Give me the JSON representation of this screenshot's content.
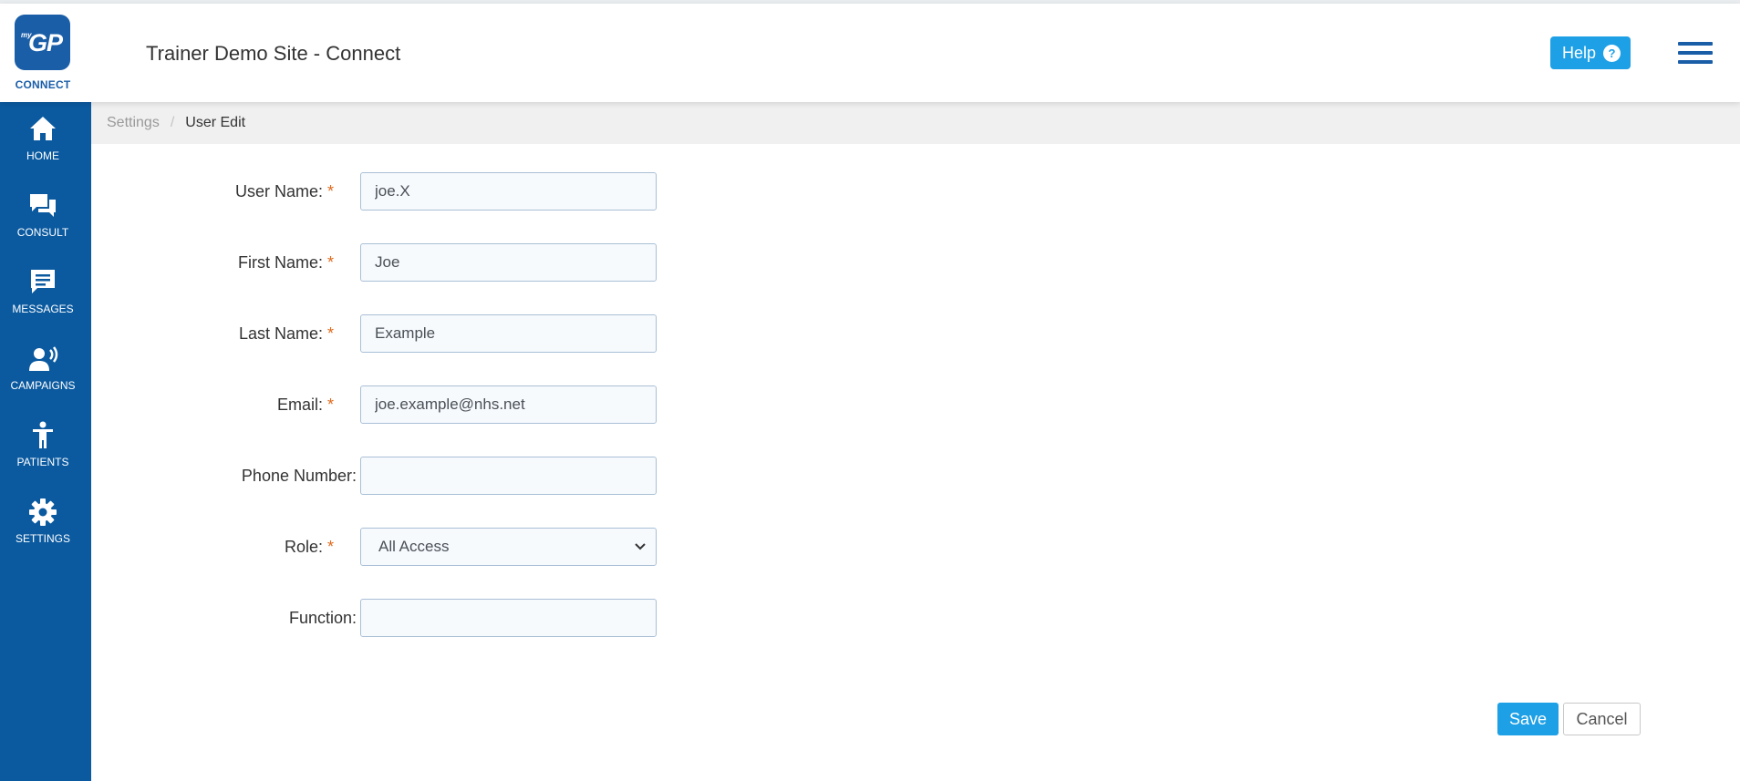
{
  "app": {
    "logo_small": "my",
    "logo_main": "GP",
    "logo_caption": "CONNECT",
    "site_title": "Trainer Demo Site - Connect"
  },
  "header": {
    "help_label": "Help",
    "help_icon": "question-circle-icon",
    "menu_icon": "hamburger-menu-icon"
  },
  "sidebar": {
    "items": [
      {
        "label": "HOME",
        "icon": "home-icon"
      },
      {
        "label": "CONSULT",
        "icon": "chat-bubbles-icon"
      },
      {
        "label": "MESSAGES",
        "icon": "message-icon"
      },
      {
        "label": "CAMPAIGNS",
        "icon": "broadcast-person-icon"
      },
      {
        "label": "PATIENTS",
        "icon": "accessibility-person-icon"
      },
      {
        "label": "SETTINGS",
        "icon": "gear-icon"
      }
    ]
  },
  "breadcrumb": {
    "parent": "Settings",
    "separator": "/",
    "current": "User Edit"
  },
  "form": {
    "required_marker": "*",
    "user_name": {
      "label": "User Name:",
      "value": "joe.X"
    },
    "first_name": {
      "label": "First Name:",
      "value": "Joe"
    },
    "last_name": {
      "label": "Last Name:",
      "value": "Example"
    },
    "email": {
      "label": "Email:",
      "value": "joe.example@nhs.net"
    },
    "phone": {
      "label": "Phone Number:",
      "value": ""
    },
    "role": {
      "label": "Role:",
      "value": "All Access"
    },
    "function": {
      "label": "Function:",
      "value": ""
    }
  },
  "actions": {
    "save_label": "Save",
    "cancel_label": "Cancel"
  },
  "colors": {
    "brand_blue": "#0b5aa0",
    "accent_blue": "#1ea0e6",
    "required_orange": "#e06a1c"
  }
}
